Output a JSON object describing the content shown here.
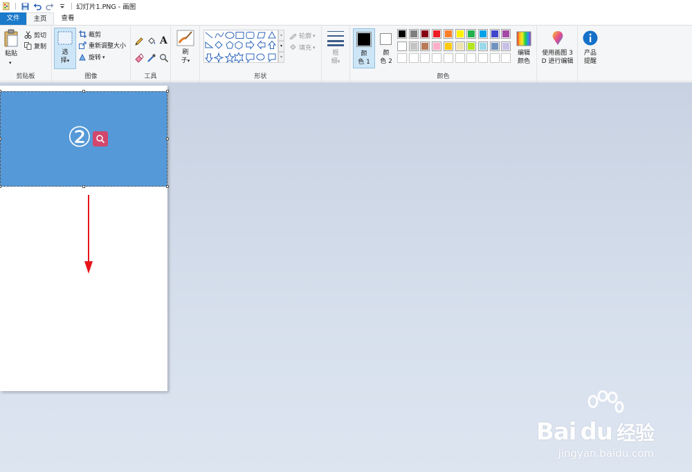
{
  "titlebar": {
    "title": "幻灯片1.PNG - 画图",
    "quick_access": [
      "app-icon",
      "save-icon",
      "undo-icon",
      "redo-icon",
      "customize-icon"
    ]
  },
  "tabs": [
    {
      "label": "文件",
      "active": false
    },
    {
      "label": "主页",
      "active": true
    },
    {
      "label": "查看",
      "active": false
    }
  ],
  "ribbon": {
    "clipboard": {
      "paste_label": "粘贴",
      "cut_label": "剪切",
      "copy_label": "复制",
      "group_label": "剪贴板"
    },
    "image": {
      "select_label_1": "选",
      "select_label_2": "择",
      "crop_label": "裁剪",
      "resize_label": "重新调整大小",
      "rotate_label": "旋转",
      "group_label": "图像"
    },
    "tools": {
      "group_label": "工具",
      "items": [
        "pencil-icon",
        "fill-icon",
        "text-icon",
        "eraser-icon",
        "color-picker-icon",
        "magnifier-icon"
      ]
    },
    "brushes": {
      "label_1": "刷",
      "label_2": "子"
    },
    "shapes": {
      "outline_label": "轮廓",
      "fill_label": "填充",
      "group_label": "形状"
    },
    "size": {
      "label_1": "粗",
      "label_2": "细"
    },
    "colors": {
      "color1_label_1": "颜",
      "color1_label_2": "色 1",
      "color2_label_1": "颜",
      "color2_label_2": "色 2",
      "edit_label_1": "编辑",
      "edit_label_2": "颜色",
      "group_label": "颜色",
      "color1": "#000000",
      "color2": "#ffffff",
      "palette_row1": [
        "#000000",
        "#7f7f7f",
        "#880015",
        "#ed1c24",
        "#ff7f27",
        "#fff200",
        "#22b14c",
        "#00a2e8",
        "#3f48cc",
        "#a349a4"
      ],
      "palette_row2": [
        "#ffffff",
        "#c3c3c3",
        "#b97a57",
        "#ffaec9",
        "#ffc90e",
        "#efe4b0",
        "#b5e61d",
        "#99d9ea",
        "#7092be",
        "#c8bfe7"
      ]
    },
    "paint3d": {
      "label_1": "使用画图 3",
      "label_2": "D 进行编辑"
    },
    "product": {
      "label_1": "产品",
      "label_2": "提醒"
    }
  },
  "canvas": {
    "step_number": "②",
    "selection_color": "#5599d8",
    "arrow_color": "#e8141b"
  },
  "watermark": {
    "brand": "Bai",
    "brand2": "du",
    "cn": "经验",
    "url": "jingyan.baidu.com"
  }
}
